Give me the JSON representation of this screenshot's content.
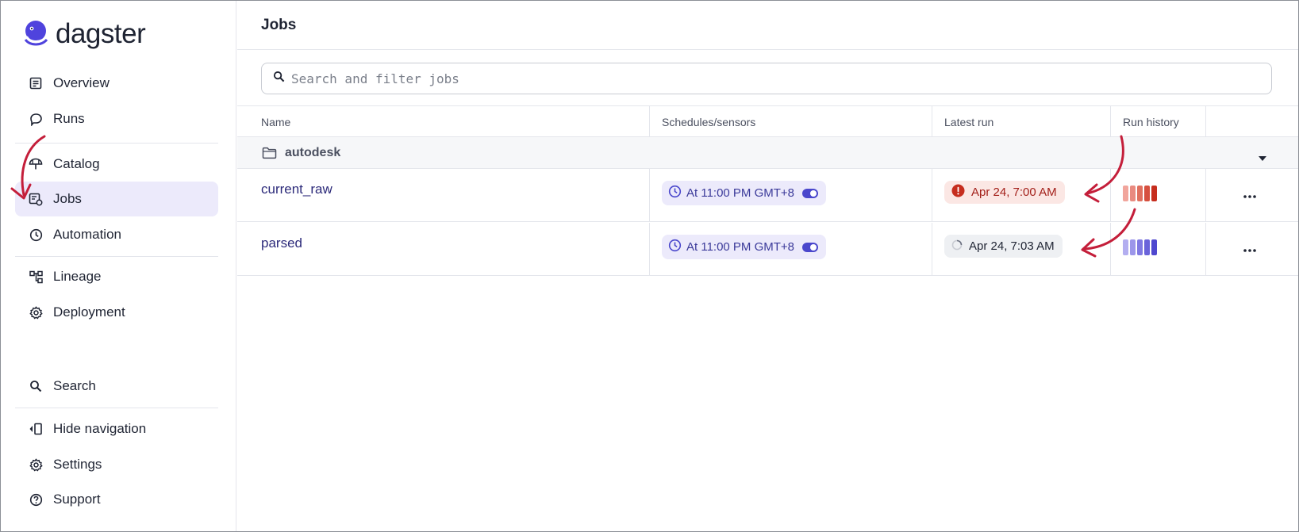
{
  "brand": {
    "name": "dagster"
  },
  "sidebar": {
    "items": [
      {
        "label": "Overview",
        "icon": "overview-icon"
      },
      {
        "label": "Runs",
        "icon": "runs-icon"
      },
      {
        "label": "Catalog",
        "icon": "catalog-icon"
      },
      {
        "label": "Jobs",
        "icon": "jobs-icon",
        "active": true
      },
      {
        "label": "Automation",
        "icon": "clock-icon"
      },
      {
        "label": "Lineage",
        "icon": "lineage-icon"
      },
      {
        "label": "Deployment",
        "icon": "gear-icon"
      },
      {
        "label": "Search",
        "icon": "search-icon"
      },
      {
        "label": "Hide navigation",
        "icon": "hide-nav-icon"
      },
      {
        "label": "Settings",
        "icon": "gear-icon"
      },
      {
        "label": "Support",
        "icon": "help-icon"
      }
    ]
  },
  "header": {
    "title": "Jobs"
  },
  "search": {
    "placeholder": "Search and filter jobs",
    "value": ""
  },
  "table": {
    "columns": [
      "Name",
      "Schedules/sensors",
      "Latest run",
      "Run history"
    ],
    "group": {
      "name": "autodesk"
    },
    "rows": [
      {
        "name": "current_raw",
        "schedule": "At 11:00 PM GMT+8",
        "latest_run": {
          "label": "Apr 24, 7:00 AM",
          "status": "failed"
        },
        "history": [
          "#f1a59c",
          "#e98a80",
          "#e0705f",
          "#d6503f",
          "#c62d1e"
        ]
      },
      {
        "name": "parsed",
        "schedule": "At 11:00 PM GMT+8",
        "latest_run": {
          "label": "Apr 24, 7:03 AM",
          "status": "running"
        },
        "history": [
          "#b3aef0",
          "#9c96ea",
          "#8079e2",
          "#6a63da",
          "#4f48cf"
        ]
      }
    ]
  },
  "colors": {
    "accent": "#4a47cc",
    "active_bg": "#eceafb",
    "failed": "#c62d1e",
    "annotation_arrow": "#c41e3a"
  }
}
